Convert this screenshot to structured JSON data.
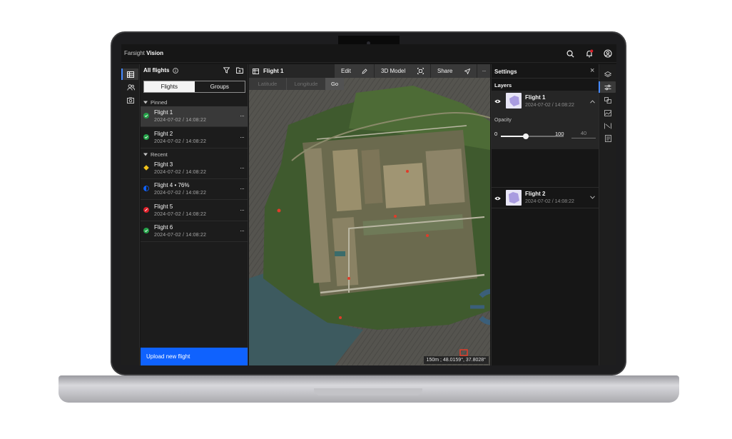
{
  "app": {
    "brand_prefix": "Farsight",
    "brand_name": "Vision"
  },
  "flight_list": {
    "title": "All flights",
    "tabs": {
      "flights": "Flights",
      "groups": "Groups",
      "active": "flights"
    },
    "sections": {
      "pinned": "Pinned",
      "recent": "Recent"
    },
    "pinned": [
      {
        "name": "Flight 1",
        "date": "2024-07-02 / 14:08:22",
        "status": "complete",
        "selected": true
      },
      {
        "name": "Flight 2",
        "date": "2024-07-02 / 14:08:22",
        "status": "complete",
        "selected": false
      }
    ],
    "recent": [
      {
        "name": "Flight 3",
        "date": "2024-07-02 / 14:08:22",
        "status": "warning"
      },
      {
        "name": "Flight 4 • 76%",
        "date": "2024-07-02 / 14:08:22",
        "status": "in-progress",
        "progress": 0.76
      },
      {
        "name": "Flight 5",
        "date": "2024-07-02 / 14:08:22",
        "status": "error"
      },
      {
        "name": "Flight 6",
        "date": "2024-07-02 / 14:08:22",
        "status": "complete"
      }
    ],
    "more": "···",
    "upload_button": "Upload new flight"
  },
  "map": {
    "title": "Flight 1",
    "toolbar": {
      "edit": "Edit",
      "model": "3D Model",
      "share": "Share",
      "more": "···"
    },
    "coords": {
      "latitude": "Latitude",
      "longitude": "Longitude",
      "go": "Go"
    },
    "scale_readout": "150m ; 48.0159°, 37.8028°"
  },
  "settings": {
    "title": "Settings",
    "close": "×",
    "layers_heading": "Layers",
    "layers": [
      {
        "name": "Flight 1",
        "date": "2024-07-02 / 14:08:22",
        "expanded": true,
        "visible": true
      },
      {
        "name": "Flight 2",
        "date": "2024-07-02 / 14:08:22",
        "expanded": false,
        "visible": true
      }
    ],
    "opacity": {
      "label": "Opacity",
      "min": "0",
      "max": "100",
      "value": "40",
      "fraction": 0.4
    }
  },
  "colors": {
    "accent": "#0f62fe",
    "complete": "#24a148",
    "warning": "#f1c21b",
    "error": "#da1e28",
    "in_progress": "#0f62fe",
    "notification": "#da1e28"
  },
  "icons": {
    "topbar": [
      "search-icon",
      "bell-icon",
      "user-icon"
    ],
    "left_rail": [
      "table-icon",
      "users-icon",
      "camera-icon"
    ],
    "right_rail": [
      "layers-icon",
      "sliders-icon",
      "compare-icon",
      "image-icon",
      "ruler-icon",
      "report-icon"
    ]
  }
}
